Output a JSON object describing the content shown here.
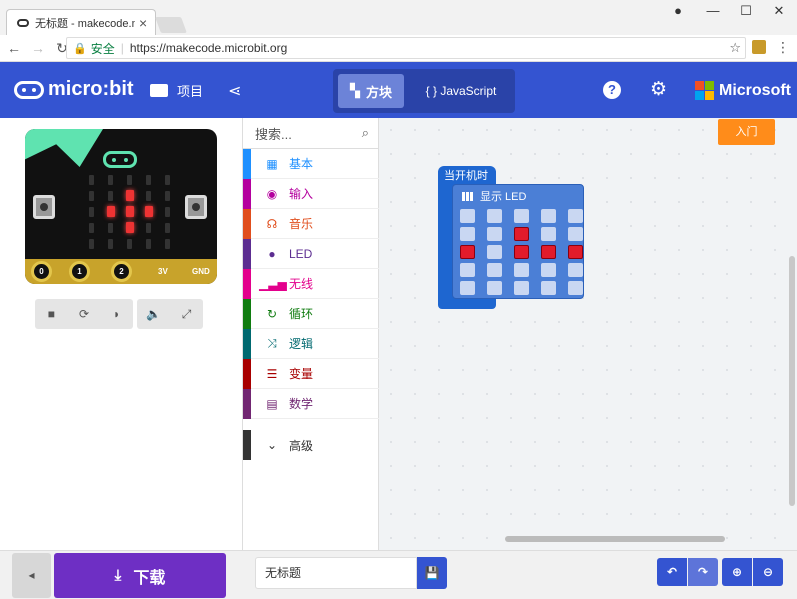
{
  "browser": {
    "tab_title": "无标题 - makecode.microbit.com",
    "close": "×",
    "secure_label": "安全",
    "url": "https://makecode.microbit.org"
  },
  "header": {
    "logo_text": "micro:bit",
    "projects_label": "项目",
    "blocks_label": "方块",
    "javascript_label": "{ } JavaScript",
    "help": "?",
    "brand": "Microsoft"
  },
  "simulator": {
    "pins": [
      "0",
      "1",
      "2",
      "3V",
      "GND"
    ],
    "leds_on": [
      [
        2,
        1
      ],
      [
        1,
        2
      ],
      [
        2,
        2
      ],
      [
        3,
        2
      ],
      [
        2,
        3
      ]
    ],
    "button_a": "A",
    "button_b": "B"
  },
  "toolbox": {
    "search_placeholder": "搜索...",
    "categories": [
      {
        "label": "基本",
        "color": "#1e90ff",
        "icon": "grid-icon"
      },
      {
        "label": "输入",
        "color": "#b4009e",
        "icon": "radio-icon"
      },
      {
        "label": "音乐",
        "color": "#e04e1d",
        "icon": "headphones-icon"
      },
      {
        "label": "LED",
        "color": "#5c2d91",
        "icon": "toggle-icon"
      },
      {
        "label": "无线",
        "color": "#e3008c",
        "icon": "signal-icon"
      },
      {
        "label": "循环",
        "color": "#107c10",
        "icon": "refresh-icon"
      },
      {
        "label": "逻辑",
        "color": "#006970",
        "icon": "shuffle-icon"
      },
      {
        "label": "变量",
        "color": "#a80000",
        "icon": "list-icon"
      },
      {
        "label": "数学",
        "color": "#712672",
        "icon": "calculator-icon"
      }
    ],
    "advanced_label": "高级"
  },
  "workspace": {
    "get_started": "入门",
    "on_start_label": "当开机时",
    "show_leds_label": "显示 LED",
    "leds_on": [
      [
        1,
        2
      ],
      [
        2,
        0
      ],
      [
        2,
        2
      ],
      [
        2,
        3
      ],
      [
        2,
        4
      ]
    ]
  },
  "bottom": {
    "download_label": "下载",
    "project_name": "无标题"
  },
  "colors": {
    "header": "#3454d1",
    "download": "#6e2fc4",
    "get_started": "#ff8c1a",
    "block": "#1e66d0"
  }
}
